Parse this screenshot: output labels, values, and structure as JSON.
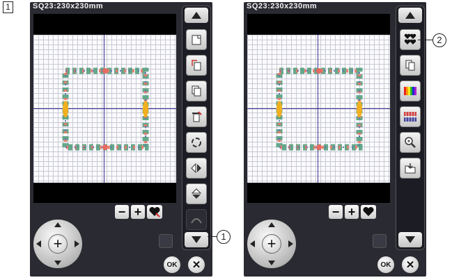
{
  "step_number": "1",
  "left_screen": {
    "title": "SQ23:230x230mm",
    "zoom_minus": "−",
    "zoom_plus": "+",
    "toolbar_icons": [
      "add-pattern-icon",
      "duplicate-icon",
      "copy-icon",
      "delete-icon",
      "rotate-icon",
      "flip-horizontal-icon",
      "flip-vertical-icon",
      "arc-text-icon"
    ],
    "ok_label": "OK",
    "cancel_label": "✕"
  },
  "right_screen": {
    "title": "SQ23:230x230mm",
    "zoom_minus": "−",
    "zoom_plus": "+",
    "toolbar_icons": [
      "grouping-icon",
      "layout-icon",
      "color-icon",
      "color-grouping-icon",
      "magnify-icon",
      "save-file-icon"
    ],
    "ok_label": "OK",
    "cancel_label": "✕"
  },
  "callouts": {
    "one": "1",
    "two": "2"
  },
  "colors": {
    "screen_bg": "#2a2a32",
    "axis": "#3a2f90",
    "grid_line": "#c8c8d4"
  }
}
